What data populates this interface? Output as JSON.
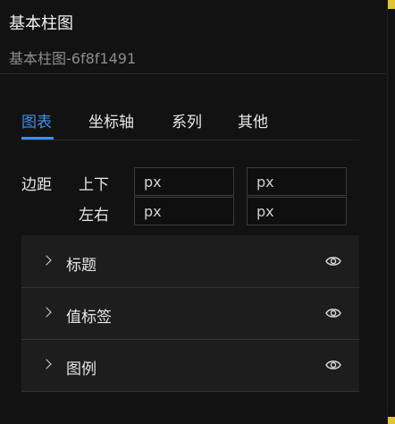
{
  "header": {
    "title": "基本柱图",
    "subtitle": "基本柱图-6f8f1491"
  },
  "tabs": {
    "items": [
      "图表",
      "坐标轴",
      "系列",
      "其他"
    ],
    "active": "图表"
  },
  "margin": {
    "label": "边距",
    "top_bottom_label": "上下",
    "left_right_label": "左右",
    "inputs": {
      "top": "px",
      "bottom": "px",
      "left": "px",
      "right": "px"
    }
  },
  "sections": [
    {
      "label": "标题",
      "icon": "chevron-right-icon",
      "action_icon": "eye-icon"
    },
    {
      "label": "值标签",
      "icon": "chevron-right-icon",
      "action_icon": "eye-icon"
    },
    {
      "label": "图例",
      "icon": "chevron-right-icon",
      "action_icon": "eye-icon"
    }
  ],
  "colors": {
    "accent": "#3f8fe3",
    "background": "#121212",
    "panel": "#1d1d1d",
    "corner_marker": "#e2c431"
  }
}
